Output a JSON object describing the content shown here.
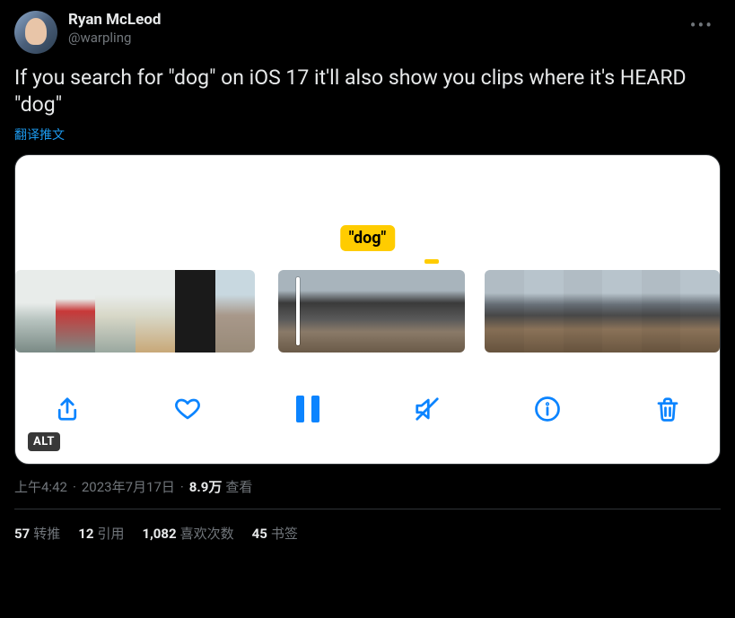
{
  "author": {
    "display_name": "Ryan McLeod",
    "handle": "@warpling"
  },
  "tweet_text": "If you search for \"dog\" on iOS 17 it'll also show you clips where it's HEARD \"dog\"",
  "translate_label": "翻译推文",
  "media": {
    "caption_badge": "\"dog\"",
    "alt_badge": "ALT",
    "toolbar_icons": {
      "share": "share-icon",
      "like": "heart-icon",
      "pause": "pause-icon",
      "mute": "mute-icon",
      "info": "info-icon",
      "trash": "trash-icon"
    }
  },
  "meta": {
    "time": "上午4:42",
    "date": "2023年7月17日",
    "views_count": "8.9万",
    "views_label": "查看"
  },
  "stats": {
    "retweets": {
      "count": "57",
      "label": "转推"
    },
    "quotes": {
      "count": "12",
      "label": "引用"
    },
    "likes": {
      "count": "1,082",
      "label": "喜欢次数"
    },
    "bookmarks": {
      "count": "45",
      "label": "书签"
    }
  }
}
